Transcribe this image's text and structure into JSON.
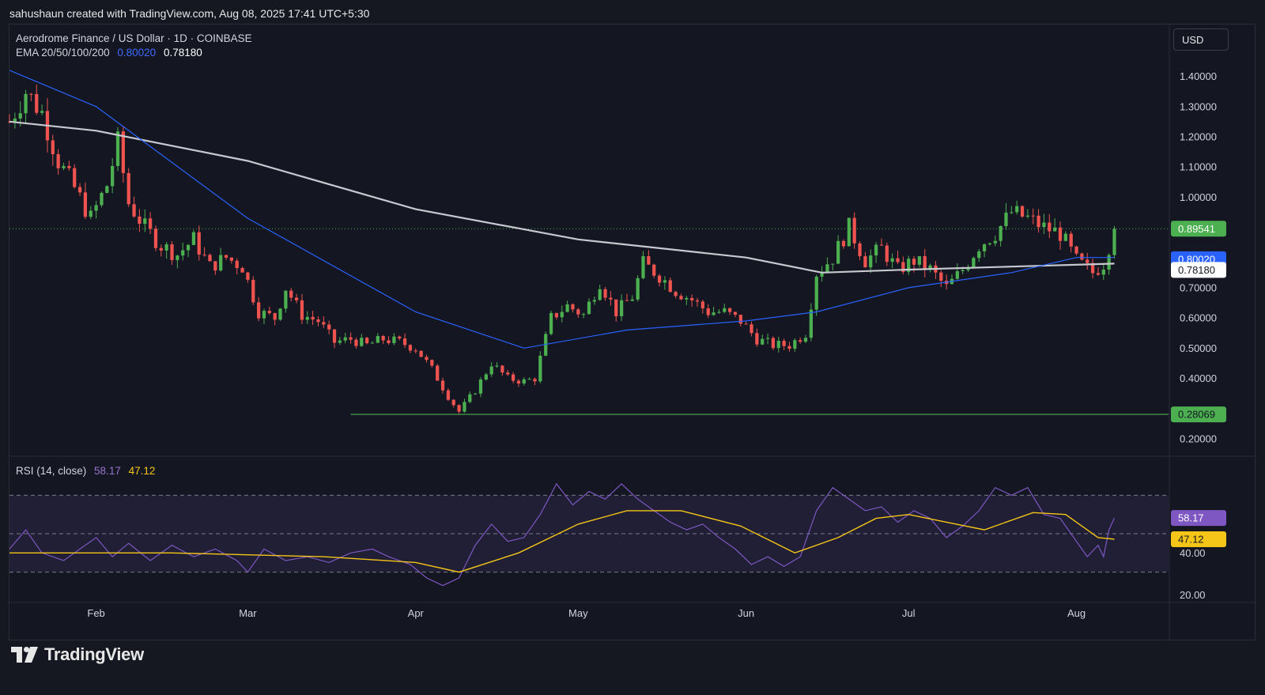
{
  "header": {
    "attribution": "sahushaun created with TradingView.com, Aug 08, 2025 17:41 UTC+5:30"
  },
  "price_legend": {
    "title": "Aerodrome Finance / US Dollar · 1D · COINBASE",
    "ema_label": "EMA 20/50/100/200",
    "ema_blue": "0.80020",
    "ema_white": "0.78180"
  },
  "rsi_legend": {
    "title": "RSI (14, close)",
    "rsi_value": "58.17",
    "ma_value": "47.12"
  },
  "currency_button": "USD",
  "brand": "TradingView",
  "colors": {
    "up": "#4caf50",
    "down": "#ef5350",
    "ema_blue": "#2962ff",
    "ema_white": "#c7c9cf",
    "rsi_line": "#7e57c2",
    "rsi_ma": "#f5c518",
    "support": "#4caf50",
    "background": "#141722"
  },
  "chart_data": [
    {
      "type": "candlestick",
      "title": "Aerodrome Finance / US Dollar · 1D · COINBASE",
      "y_scale": "linear",
      "ylim": [
        0.15,
        1.48
      ],
      "y_ticks": [
        "1.40000",
        "1.30000",
        "1.20000",
        "1.10000",
        "1.00000",
        "0.70000",
        "0.60000",
        "0.50000",
        "0.40000",
        "0.20000"
      ],
      "x_ticks": [
        "Feb",
        "Mar",
        "Apr",
        "May",
        "Jun",
        "Jul",
        "Aug"
      ],
      "x_range": [
        "2025-01-16",
        "2025-08-18"
      ],
      "current_price": "0.89541",
      "support_level": "0.28069",
      "support_start": "2025-03-20",
      "ema_labels": [
        "0.80020",
        "0.78180"
      ],
      "close_anchors": [
        [
          "2025-01-16",
          1.25
        ],
        [
          "2025-01-19",
          1.35
        ],
        [
          "2025-01-22",
          1.28
        ],
        [
          "2025-01-25",
          1.12
        ],
        [
          "2025-01-28",
          1.03
        ],
        [
          "2025-01-31",
          0.93
        ],
        [
          "2025-02-03",
          1.04
        ],
        [
          "2025-02-05",
          1.18
        ],
        [
          "2025-02-07",
          0.98
        ],
        [
          "2025-02-10",
          0.9
        ],
        [
          "2025-02-13",
          0.84
        ],
        [
          "2025-02-16",
          0.81
        ],
        [
          "2025-02-19",
          0.86
        ],
        [
          "2025-02-22",
          0.77
        ],
        [
          "2025-02-25",
          0.8
        ],
        [
          "2025-02-28",
          0.77
        ],
        [
          "2025-03-03",
          0.62
        ],
        [
          "2025-03-06",
          0.6
        ],
        [
          "2025-03-08",
          0.7
        ],
        [
          "2025-03-11",
          0.61
        ],
        [
          "2025-03-14",
          0.59
        ],
        [
          "2025-03-17",
          0.52
        ],
        [
          "2025-03-20",
          0.53
        ],
        [
          "2025-03-23",
          0.51
        ],
        [
          "2025-03-26",
          0.53
        ],
        [
          "2025-03-29",
          0.52
        ],
        [
          "2025-04-01",
          0.5
        ],
        [
          "2025-04-04",
          0.43
        ],
        [
          "2025-04-07",
          0.34
        ],
        [
          "2025-04-09",
          0.29
        ],
        [
          "2025-04-12",
          0.36
        ],
        [
          "2025-04-15",
          0.45
        ],
        [
          "2025-04-18",
          0.4
        ],
        [
          "2025-04-21",
          0.39
        ],
        [
          "2025-04-23",
          0.4
        ],
        [
          "2025-04-26",
          0.6
        ],
        [
          "2025-04-29",
          0.64
        ],
        [
          "2025-05-02",
          0.61
        ],
        [
          "2025-05-05",
          0.72
        ],
        [
          "2025-05-08",
          0.62
        ],
        [
          "2025-05-11",
          0.67
        ],
        [
          "2025-05-13",
          0.78
        ],
        [
          "2025-05-16",
          0.74
        ],
        [
          "2025-05-19",
          0.69
        ],
        [
          "2025-05-22",
          0.66
        ],
        [
          "2025-05-25",
          0.62
        ],
        [
          "2025-05-28",
          0.62
        ],
        [
          "2025-05-31",
          0.59
        ],
        [
          "2025-06-03",
          0.53
        ],
        [
          "2025-06-06",
          0.51
        ],
        [
          "2025-06-09",
          0.51
        ],
        [
          "2025-06-12",
          0.55
        ],
        [
          "2025-06-14",
          0.75
        ],
        [
          "2025-06-17",
          0.8
        ],
        [
          "2025-06-20",
          0.9
        ],
        [
          "2025-06-23",
          0.79
        ],
        [
          "2025-06-26",
          0.83
        ],
        [
          "2025-06-29",
          0.76
        ],
        [
          "2025-07-02",
          0.79
        ],
        [
          "2025-07-05",
          0.76
        ],
        [
          "2025-07-08",
          0.7
        ],
        [
          "2025-07-11",
          0.76
        ],
        [
          "2025-07-14",
          0.84
        ],
        [
          "2025-07-17",
          0.88
        ],
        [
          "2025-07-20",
          0.95
        ],
        [
          "2025-07-23",
          0.93
        ],
        [
          "2025-07-26",
          0.9
        ],
        [
          "2025-07-29",
          0.88
        ],
        [
          "2025-08-01",
          0.79
        ],
        [
          "2025-08-04",
          0.75
        ],
        [
          "2025-08-06",
          0.78
        ],
        [
          "2025-08-08",
          0.895
        ]
      ],
      "ema_blue_points": [
        [
          "2025-01-16",
          1.42
        ],
        [
          "2025-02-01",
          1.3
        ],
        [
          "2025-03-01",
          0.93
        ],
        [
          "2025-04-01",
          0.62
        ],
        [
          "2025-04-21",
          0.5
        ],
        [
          "2025-05-10",
          0.56
        ],
        [
          "2025-06-01",
          0.59
        ],
        [
          "2025-06-14",
          0.62
        ],
        [
          "2025-07-01",
          0.7
        ],
        [
          "2025-07-20",
          0.75
        ],
        [
          "2025-08-01",
          0.8
        ],
        [
          "2025-08-08",
          0.8
        ]
      ],
      "ema_white_points": [
        [
          "2025-01-16",
          1.25
        ],
        [
          "2025-02-01",
          1.22
        ],
        [
          "2025-03-01",
          1.12
        ],
        [
          "2025-04-01",
          0.96
        ],
        [
          "2025-05-01",
          0.86
        ],
        [
          "2025-06-01",
          0.8
        ],
        [
          "2025-06-15",
          0.75
        ],
        [
          "2025-07-01",
          0.76
        ],
        [
          "2025-07-20",
          0.77
        ],
        [
          "2025-08-08",
          0.78
        ]
      ]
    },
    {
      "type": "line",
      "title": "RSI (14, close)",
      "ylim": [
        15,
        85
      ],
      "y_ticks": [
        "40.00",
        "20.00"
      ],
      "band": [
        30,
        70
      ],
      "mid_line": 50,
      "current_values": [
        "58.17",
        "47.12"
      ],
      "rsi_points": [
        [
          "2025-01-16",
          42
        ],
        [
          "2025-01-19",
          52
        ],
        [
          "2025-01-22",
          40
        ],
        [
          "2025-01-26",
          36
        ],
        [
          "2025-01-29",
          42
        ],
        [
          "2025-02-01",
          48
        ],
        [
          "2025-02-04",
          38
        ],
        [
          "2025-02-07",
          45
        ],
        [
          "2025-02-11",
          36
        ],
        [
          "2025-02-15",
          44
        ],
        [
          "2025-02-19",
          38
        ],
        [
          "2025-02-23",
          42
        ],
        [
          "2025-02-27",
          36
        ],
        [
          "2025-03-01",
          30
        ],
        [
          "2025-03-04",
          42
        ],
        [
          "2025-03-08",
          36
        ],
        [
          "2025-03-12",
          38
        ],
        [
          "2025-03-16",
          35
        ],
        [
          "2025-03-20",
          40
        ],
        [
          "2025-03-24",
          42
        ],
        [
          "2025-03-27",
          38
        ],
        [
          "2025-03-31",
          34
        ],
        [
          "2025-04-03",
          27
        ],
        [
          "2025-04-06",
          23
        ],
        [
          "2025-04-09",
          27
        ],
        [
          "2025-04-12",
          44
        ],
        [
          "2025-04-15",
          55
        ],
        [
          "2025-04-18",
          46
        ],
        [
          "2025-04-21",
          48
        ],
        [
          "2025-04-24",
          60
        ],
        [
          "2025-04-27",
          76
        ],
        [
          "2025-04-30",
          65
        ],
        [
          "2025-05-03",
          72
        ],
        [
          "2025-05-06",
          68
        ],
        [
          "2025-05-09",
          76
        ],
        [
          "2025-05-12",
          68
        ],
        [
          "2025-05-15",
          62
        ],
        [
          "2025-05-18",
          56
        ],
        [
          "2025-05-21",
          52
        ],
        [
          "2025-05-24",
          55
        ],
        [
          "2025-05-27",
          48
        ],
        [
          "2025-05-30",
          42
        ],
        [
          "2025-06-02",
          34
        ],
        [
          "2025-06-05",
          38
        ],
        [
          "2025-06-08",
          33
        ],
        [
          "2025-06-11",
          38
        ],
        [
          "2025-06-14",
          62
        ],
        [
          "2025-06-17",
          74
        ],
        [
          "2025-06-20",
          68
        ],
        [
          "2025-06-23",
          62
        ],
        [
          "2025-06-26",
          64
        ],
        [
          "2025-06-29",
          56
        ],
        [
          "2025-07-02",
          62
        ],
        [
          "2025-07-05",
          58
        ],
        [
          "2025-07-08",
          48
        ],
        [
          "2025-07-11",
          54
        ],
        [
          "2025-07-14",
          62
        ],
        [
          "2025-07-17",
          74
        ],
        [
          "2025-07-20",
          70
        ],
        [
          "2025-07-23",
          74
        ],
        [
          "2025-07-26",
          60
        ],
        [
          "2025-07-29",
          58
        ],
        [
          "2025-08-01",
          46
        ],
        [
          "2025-08-03",
          38
        ],
        [
          "2025-08-05",
          44
        ],
        [
          "2025-08-06",
          38
        ],
        [
          "2025-08-07",
          52
        ],
        [
          "2025-08-08",
          58.17
        ]
      ],
      "rsi_ma_points": [
        [
          "2025-01-16",
          40
        ],
        [
          "2025-02-15",
          40
        ],
        [
          "2025-03-15",
          38
        ],
        [
          "2025-04-01",
          35
        ],
        [
          "2025-04-09",
          30
        ],
        [
          "2025-04-20",
          40
        ],
        [
          "2025-05-01",
          55
        ],
        [
          "2025-05-10",
          62
        ],
        [
          "2025-05-20",
          62
        ],
        [
          "2025-05-31",
          54
        ],
        [
          "2025-06-10",
          40
        ],
        [
          "2025-06-18",
          48
        ],
        [
          "2025-06-25",
          58
        ],
        [
          "2025-07-01",
          60
        ],
        [
          "2025-07-08",
          56
        ],
        [
          "2025-07-15",
          52
        ],
        [
          "2025-07-24",
          61
        ],
        [
          "2025-07-30",
          60
        ],
        [
          "2025-08-05",
          48
        ],
        [
          "2025-08-08",
          47.12
        ]
      ]
    }
  ]
}
